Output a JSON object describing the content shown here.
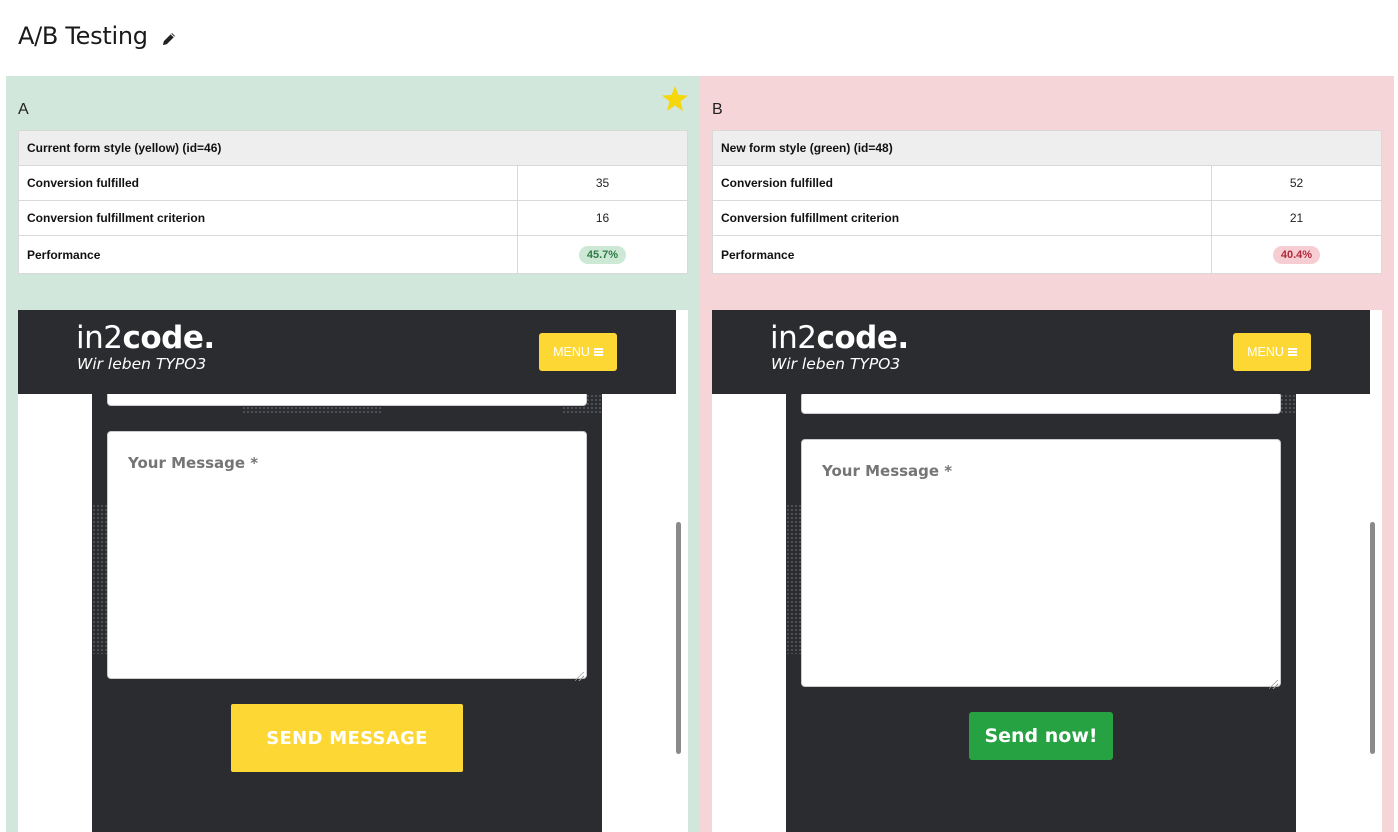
{
  "page": {
    "title": "A/B Testing",
    "edit_icon": "pencil-icon"
  },
  "variants": [
    {
      "label": "A",
      "winner_icon": "star-icon",
      "winner_color": "#f6d60d",
      "form_name": "Current form style (yellow) (id=46)",
      "rows": [
        {
          "label": "Conversion fulfilled",
          "value": "35"
        },
        {
          "label": "Conversion fulfillment criterion",
          "value": "16"
        }
      ],
      "performance_label": "Performance",
      "performance_value": "45.7%",
      "preview": {
        "logo_light": "in2",
        "logo_bold": "code.",
        "logo_tagline": "Wir leben TYPO3",
        "menu_label": "MENU",
        "menu_icon": "bars-icon",
        "message_placeholder": "Your Message *",
        "send_label": "SEND MESSAGE",
        "send_color": "#fdd835"
      }
    },
    {
      "label": "B",
      "form_name": "New form style (green) (id=48)",
      "rows": [
        {
          "label": "Conversion fulfilled",
          "value": "52"
        },
        {
          "label": "Conversion fulfillment criterion",
          "value": "21"
        }
      ],
      "performance_label": "Performance",
      "performance_value": "40.4%",
      "preview": {
        "logo_light": "in2",
        "logo_bold": "code.",
        "logo_tagline": "Wir leben TYPO3",
        "menu_label": "MENU",
        "menu_icon": "bars-icon",
        "message_placeholder": "Your Message *",
        "send_label": "Send now!",
        "send_color": "#27a243"
      }
    }
  ],
  "colors": {
    "variant_a_bg": "#d2e7dc",
    "variant_b_bg": "#f5d5d8",
    "site_dark": "#2a2c2f"
  }
}
